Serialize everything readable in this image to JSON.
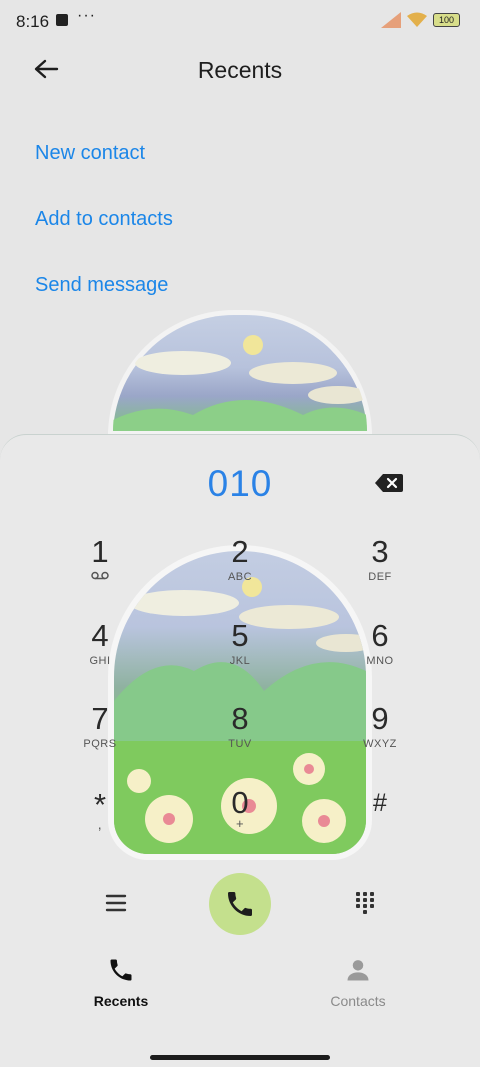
{
  "status_bar": {
    "time": "8:16",
    "dots": "···",
    "battery": "100"
  },
  "header": {
    "title": "Recents"
  },
  "actions": [
    {
      "label": "New contact"
    },
    {
      "label": "Add to contacts"
    },
    {
      "label": "Send message"
    }
  ],
  "dialer": {
    "number": "010",
    "keys": [
      {
        "digit": "1",
        "letters": ""
      },
      {
        "digit": "2",
        "letters": "ABC"
      },
      {
        "digit": "3",
        "letters": "DEF"
      },
      {
        "digit": "4",
        "letters": "GHI"
      },
      {
        "digit": "5",
        "letters": "JKL"
      },
      {
        "digit": "6",
        "letters": "MNO"
      },
      {
        "digit": "7",
        "letters": "PQRS"
      },
      {
        "digit": "8",
        "letters": "TUV"
      },
      {
        "digit": "9",
        "letters": "WXYZ"
      },
      {
        "digit": "*",
        "letters": ","
      },
      {
        "digit": "0",
        "letters": "+"
      },
      {
        "digit": "#",
        "letters": ""
      }
    ]
  },
  "bottom_nav": {
    "recents": "Recents",
    "contacts": "Contacts"
  },
  "colors": {
    "accent_blue": "#1b86e8",
    "call_green": "#c4e08d"
  }
}
